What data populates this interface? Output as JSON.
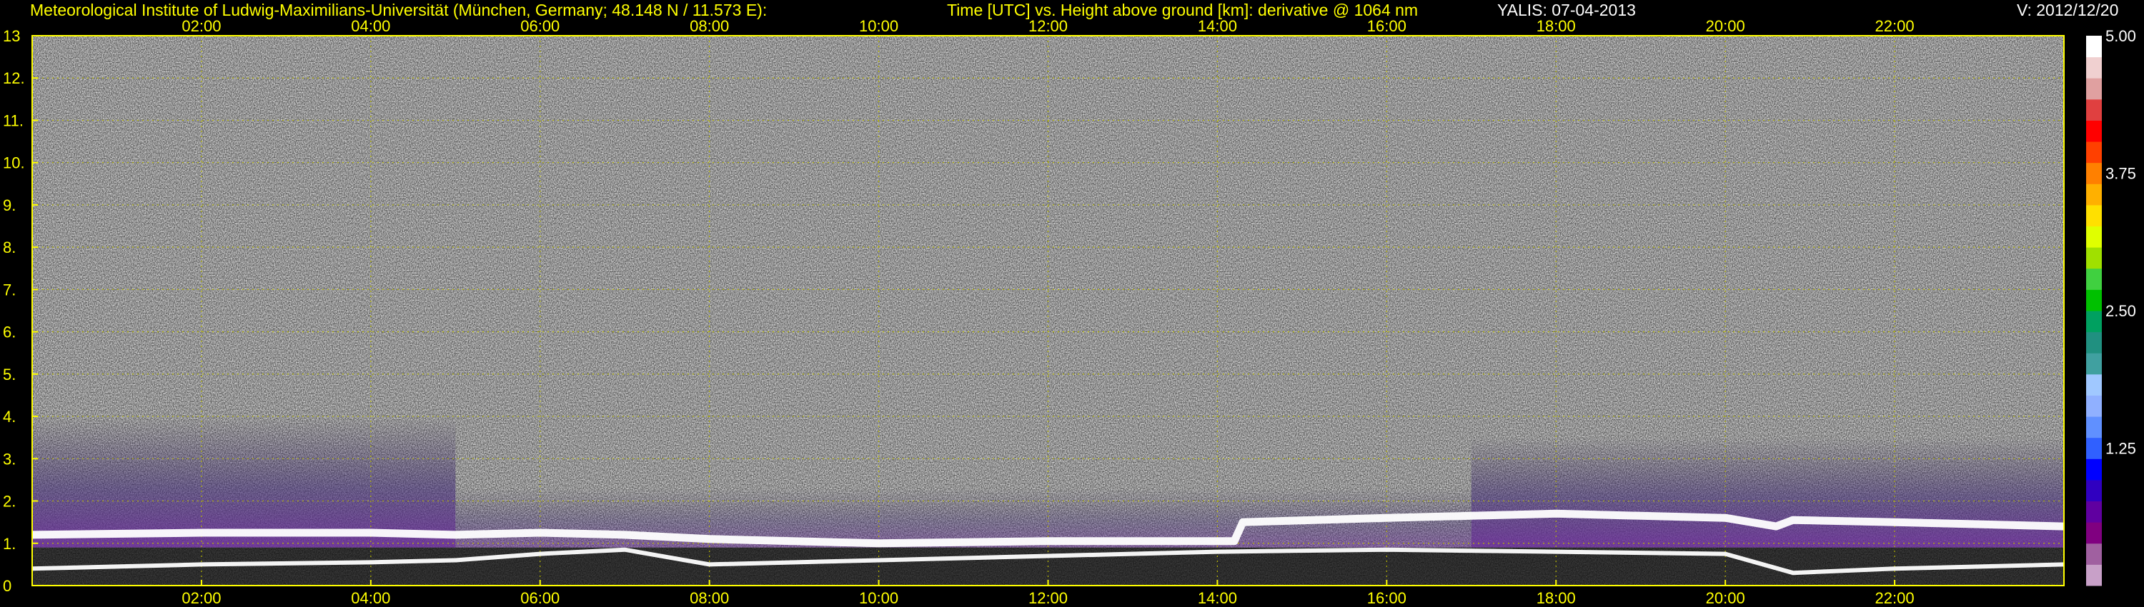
{
  "header": {
    "institute": "Meteorological Institute of Ludwig-Maximilians-Universität (München, Germany; 48.148 N / 11.573 E):",
    "description": "Time [UTC] vs. Height above ground [km]: derivative @ 1064 nm",
    "instrument_date": "YALIS: 07-04-2013",
    "version": "V: 2012/12/20"
  },
  "colors": {
    "axis": "#ffff00",
    "grid": "#b8b800",
    "background": "#000000",
    "layer": "#ffffff"
  },
  "chart_data": {
    "type": "heatmap",
    "xlabel": "Time [UTC]",
    "ylabel": "Height above ground [km]",
    "xlim": [
      0,
      24
    ],
    "ylim": [
      0,
      13
    ],
    "x_ticks": [
      "02:00",
      "04:00",
      "06:00",
      "08:00",
      "10:00",
      "12:00",
      "14:00",
      "16:00",
      "18:00",
      "20:00",
      "22:00"
    ],
    "x_tick_values": [
      2,
      4,
      6,
      8,
      10,
      12,
      14,
      16,
      18,
      20,
      22
    ],
    "y_ticks": [
      "0",
      "1.",
      "2.",
      "3.",
      "4.",
      "5.",
      "6.",
      "7.",
      "8.",
      "9.",
      "10.",
      "11.",
      "12.",
      "13"
    ],
    "y_tick_values": [
      0,
      1,
      2,
      3,
      4,
      5,
      6,
      7,
      8,
      9,
      10,
      11,
      12,
      13
    ],
    "grid": true,
    "colorbar": {
      "labels": [
        "5.00",
        "3.75",
        "2.50",
        "1.25"
      ],
      "values": [
        5.0,
        3.75,
        2.5,
        1.25
      ],
      "range": [
        0,
        5
      ],
      "colors": [
        "#c8a0c8",
        "#a060a0",
        "#800080",
        "#6000a0",
        "#3000c0",
        "#0000ff",
        "#3060ff",
        "#6090ff",
        "#90b0ff",
        "#a0c8ff",
        "#40a0a0",
        "#209080",
        "#00a060",
        "#00c000",
        "#40d040",
        "#a0e000",
        "#e0ff00",
        "#ffe000",
        "#ffb000",
        "#ff8000",
        "#ff4000",
        "#ff0000",
        "#e04040",
        "#e0a0a0",
        "#f0d0d0",
        "#ffffff"
      ]
    },
    "layers": [
      {
        "name": "boundary-layer-top",
        "points": [
          [
            0,
            1.2
          ],
          [
            2,
            1.25
          ],
          [
            4,
            1.25
          ],
          [
            5,
            1.2
          ],
          [
            6,
            1.25
          ],
          [
            7,
            1.2
          ],
          [
            8,
            1.1
          ],
          [
            10,
            1.0
          ],
          [
            12,
            1.05
          ],
          [
            13,
            1.05
          ],
          [
            14.2,
            1.05
          ],
          [
            14.3,
            1.5
          ],
          [
            16,
            1.6
          ],
          [
            17,
            1.65
          ],
          [
            18,
            1.7
          ],
          [
            19,
            1.65
          ],
          [
            20,
            1.6
          ],
          [
            20.6,
            1.4
          ],
          [
            20.8,
            1.55
          ],
          [
            22,
            1.5
          ],
          [
            24,
            1.4
          ]
        ]
      },
      {
        "name": "lower-layer",
        "points": [
          [
            0,
            0.4
          ],
          [
            2,
            0.5
          ],
          [
            4,
            0.55
          ],
          [
            5,
            0.6
          ],
          [
            6,
            0.75
          ],
          [
            7,
            0.85
          ],
          [
            8,
            0.5
          ],
          [
            10,
            0.6
          ],
          [
            12,
            0.7
          ],
          [
            14,
            0.8
          ],
          [
            16,
            0.85
          ],
          [
            18,
            0.8
          ],
          [
            20,
            0.75
          ],
          [
            20.8,
            0.3
          ],
          [
            22,
            0.4
          ],
          [
            24,
            0.5
          ]
        ]
      }
    ]
  }
}
